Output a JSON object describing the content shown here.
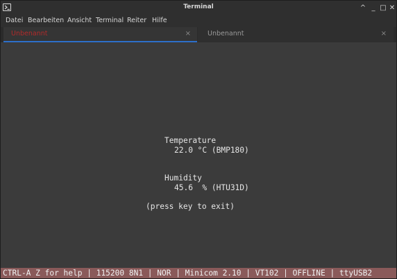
{
  "window": {
    "title": "Terminal",
    "icon": "terminal-icon",
    "controls": {
      "minimize_up": "^",
      "minimize": "_",
      "maximize": "□",
      "close": "✕"
    }
  },
  "menu": {
    "items": [
      "Datei",
      "Bearbeiten",
      "Ansicht",
      "Terminal",
      "Reiter",
      "Hilfe"
    ]
  },
  "tabs": [
    {
      "label": "Unbenannt",
      "active": true,
      "close": "×"
    },
    {
      "label": "Unbenannt",
      "active": false,
      "close": "×"
    }
  ],
  "terminal": {
    "temperature_heading": "Temperature",
    "temperature_value": "22.0 °C (BMP180)",
    "humidity_heading": "Humidity",
    "humidity_value": "45.6  % (HTU31D)",
    "exit_hint": "(press key to exit)"
  },
  "status_line": "CTRL-A Z for help | 115200 8N1 | NOR | Minicom 2.10 | VT102 | OFFLINE | ttyUSB2",
  "colors": {
    "active_tab_underline": "#2d6fc9",
    "active_tab_label": "#b22a2a",
    "status_bar": "#8a5a5a"
  }
}
